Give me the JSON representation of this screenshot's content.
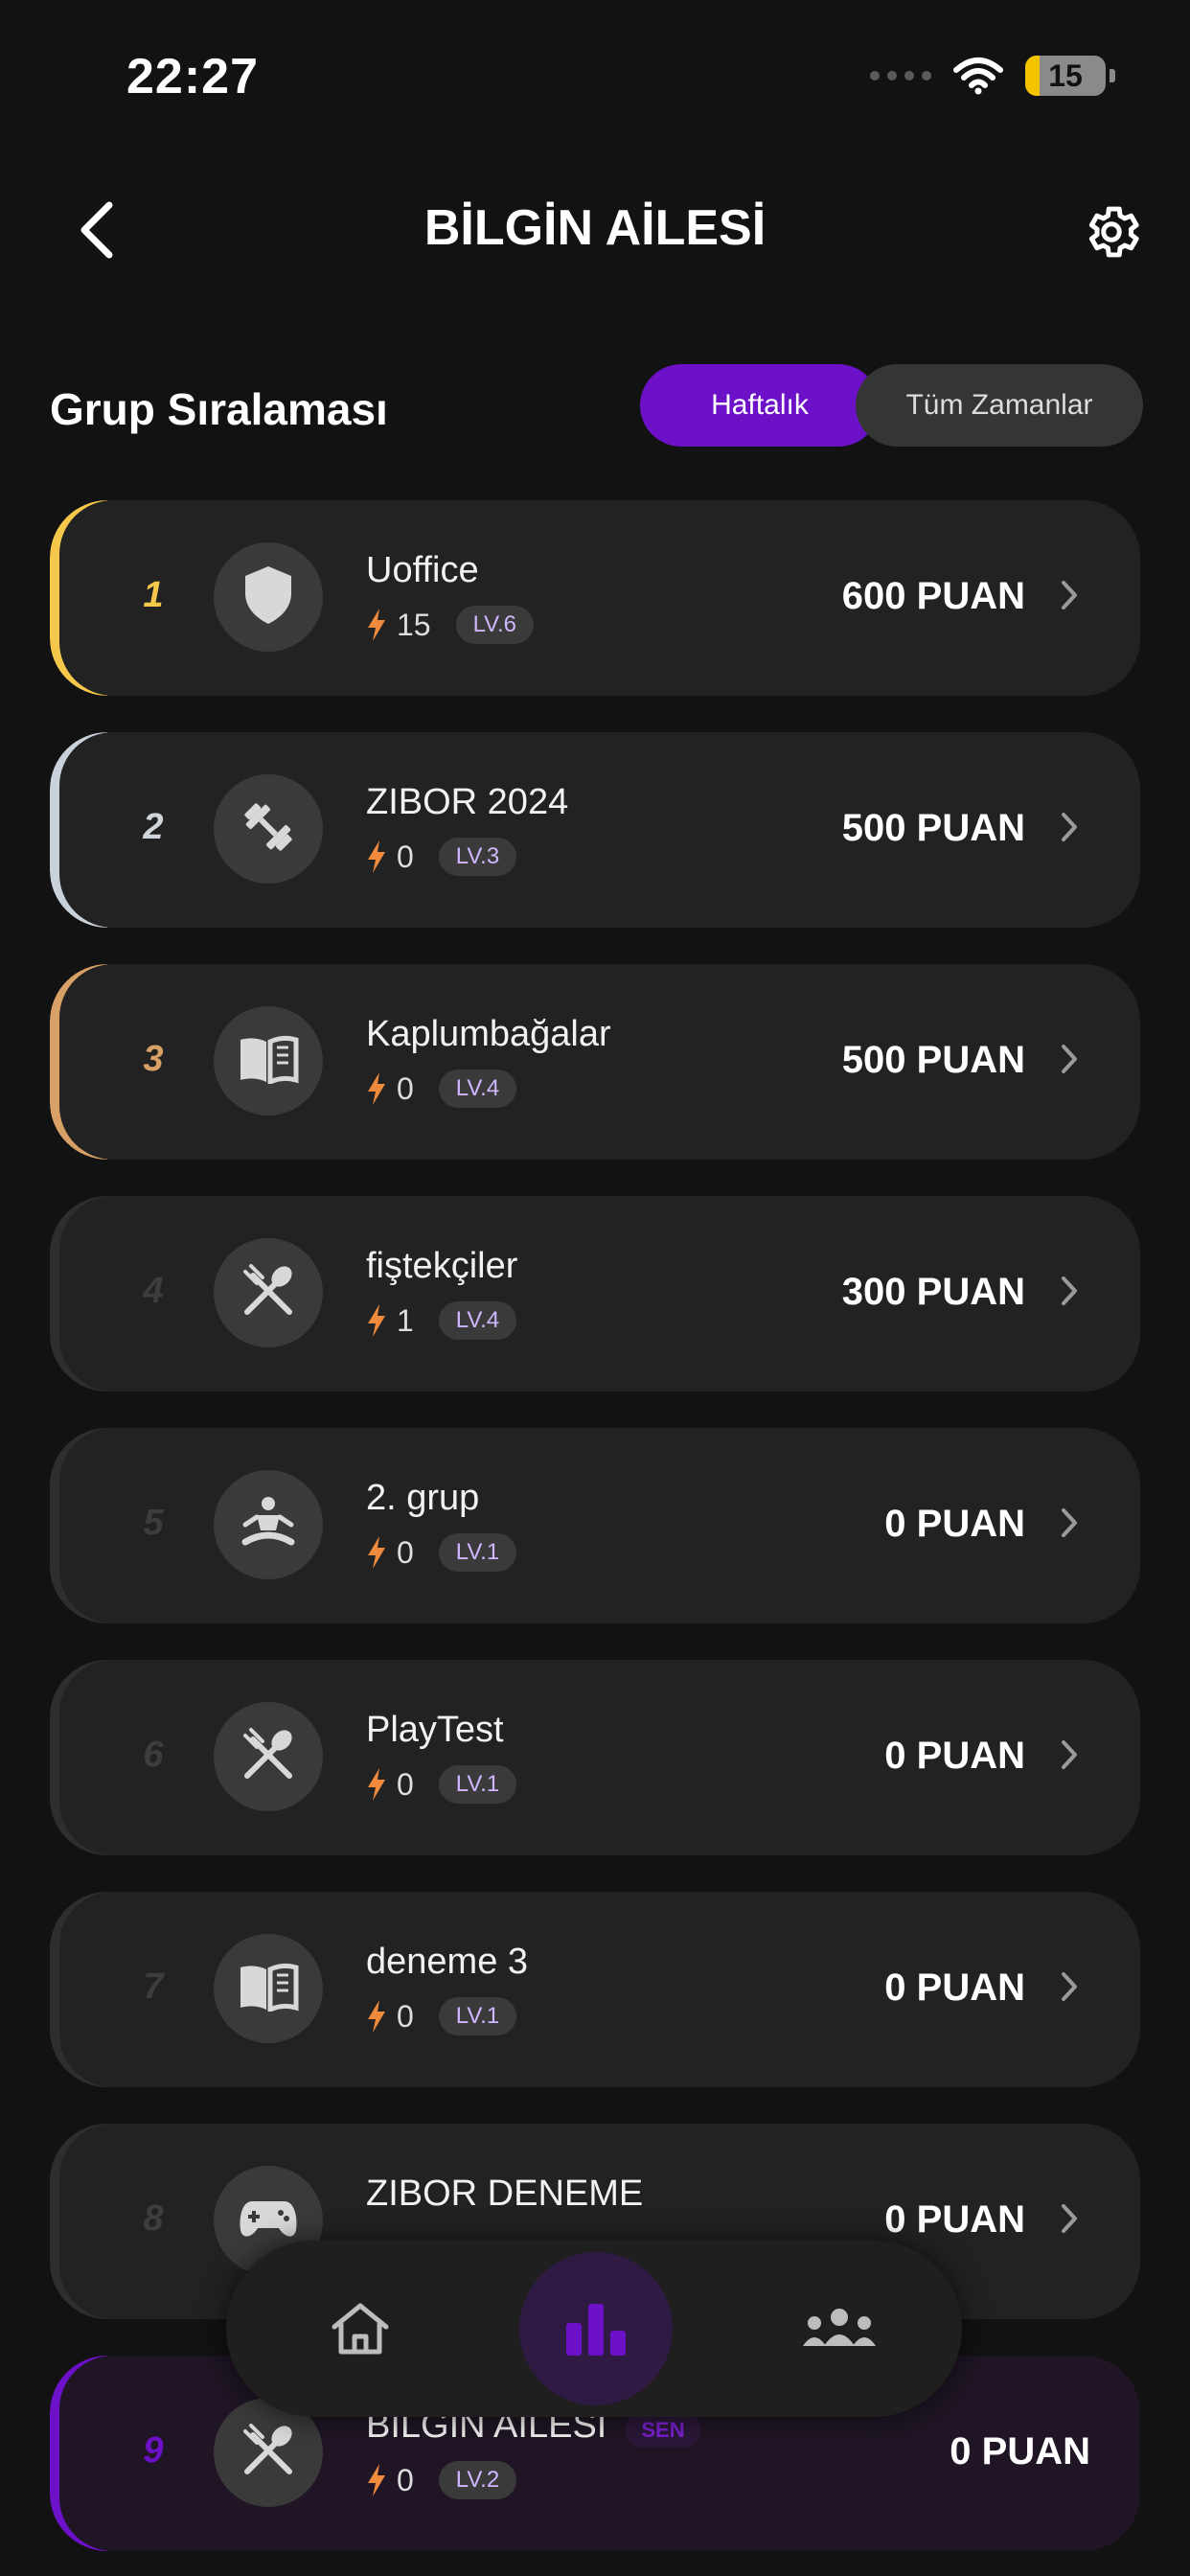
{
  "status": {
    "time": "22:27",
    "battery": "15"
  },
  "header": {
    "title": "BİLGİN AİLESİ"
  },
  "section": {
    "title": "Grup Sıralaması",
    "tabs": [
      "Haftalık",
      "Tüm Zamanlar"
    ],
    "active_tab": "Haftalık"
  },
  "colors": {
    "accent": "#6c11c8",
    "gold": "#f5c84c",
    "silver": "#c9d2da",
    "bronze": "#d8a066",
    "streak": "#f08a3c"
  },
  "groups": [
    {
      "rank": "1",
      "name": "Uoffice",
      "streak": "15",
      "level": "LV.6",
      "points": "600 PUAN",
      "icon": "shield-icon"
    },
    {
      "rank": "2",
      "name": "ZIBOR 2024",
      "streak": "0",
      "level": "LV.3",
      "points": "500 PUAN",
      "icon": "dumbbell-icon"
    },
    {
      "rank": "3",
      "name": "Kaplumbağalar",
      "streak": "0",
      "level": "LV.4",
      "points": "500 PUAN",
      "icon": "book-icon"
    },
    {
      "rank": "4",
      "name": "fiştekçiler",
      "streak": "1",
      "level": "LV.4",
      "points": "300 PUAN",
      "icon": "utensils-icon"
    },
    {
      "rank": "5",
      "name": "2. grup",
      "streak": "0",
      "level": "LV.1",
      "points": "0 PUAN",
      "icon": "meditation-icon"
    },
    {
      "rank": "6",
      "name": "PlayTest",
      "streak": "0",
      "level": "LV.1",
      "points": "0 PUAN",
      "icon": "utensils-icon"
    },
    {
      "rank": "7",
      "name": "deneme 3",
      "streak": "0",
      "level": "LV.1",
      "points": "0 PUAN",
      "icon": "book-icon"
    },
    {
      "rank": "8",
      "name": "ZIBOR DENEME",
      "streak": "",
      "level": "",
      "points": "0 PUAN",
      "icon": "gamepad-icon"
    },
    {
      "rank": "9",
      "name": "BİLGİN AİLESİ",
      "streak": "0",
      "level": "LV.2",
      "points": "0 PUAN",
      "icon": "utensils-icon",
      "badge": "SEN"
    }
  ],
  "nav": {
    "items": [
      "home-icon",
      "leaderboard-icon",
      "groups-icon"
    ],
    "active": "leaderboard-icon"
  }
}
